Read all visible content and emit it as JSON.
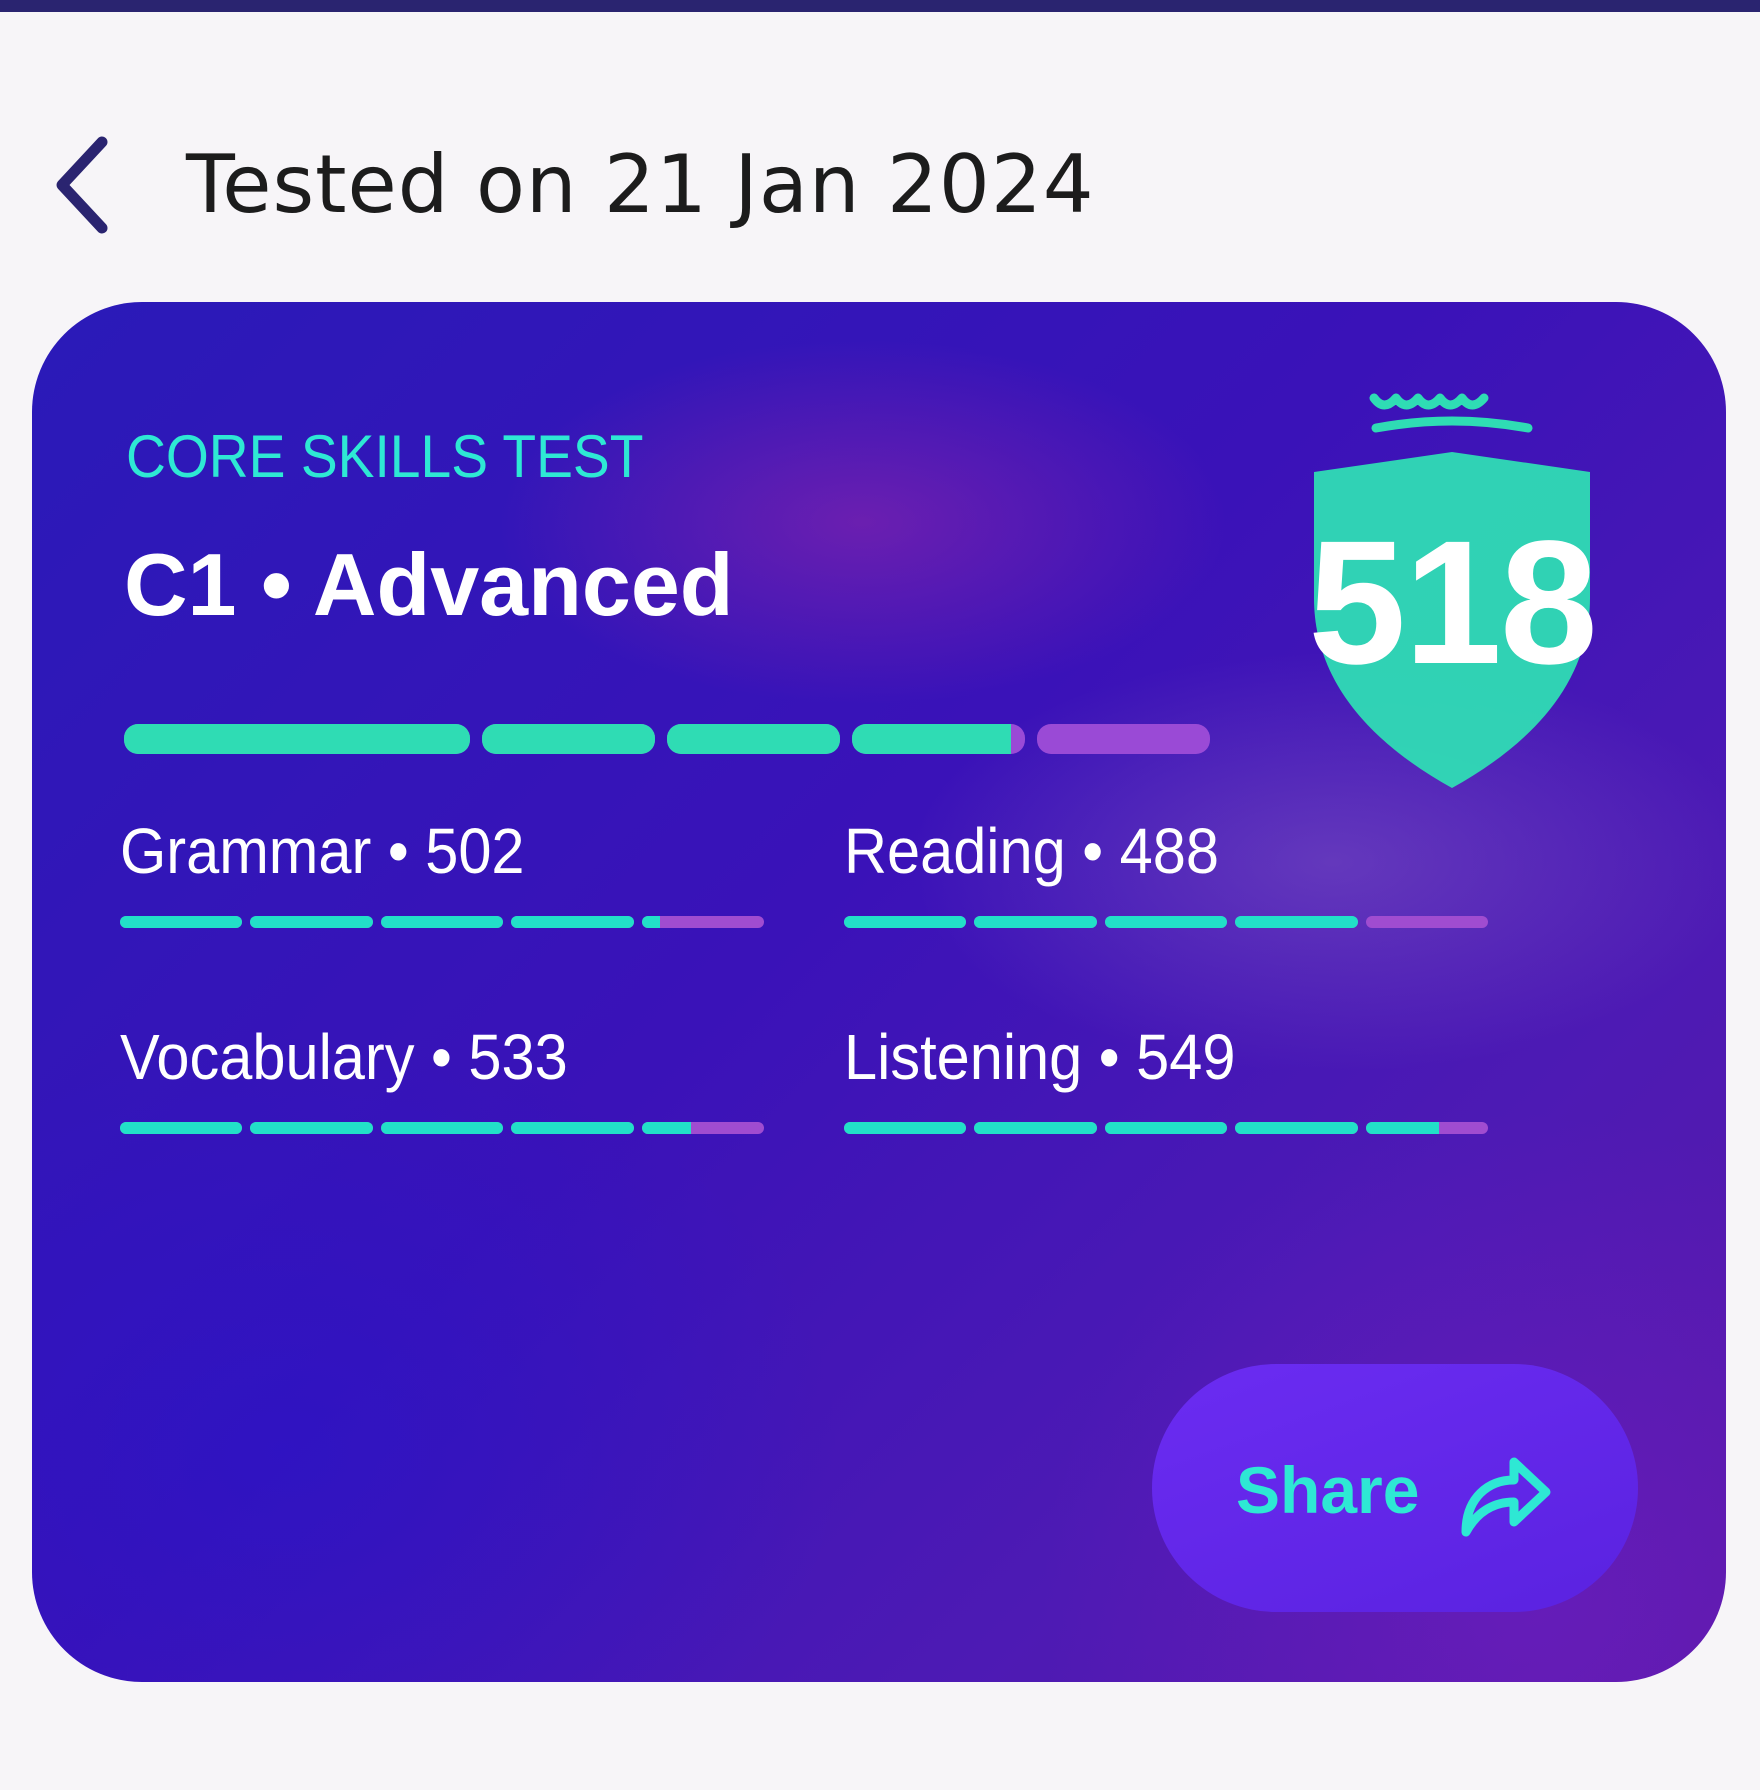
{
  "header": {
    "title": "Tested on 21 Jan 2024",
    "back_icon": "chevron-left-icon"
  },
  "result": {
    "test_name": "CORE SKILLS TEST",
    "level": "C1 • Advanced",
    "overall_score": "518",
    "badge_icon": "crown-shield-icon",
    "level_progress_fraction": 0.82
  },
  "skills": [
    {
      "label": "Grammar • 502",
      "progress_fraction": 0.83
    },
    {
      "label": "Reading • 488",
      "progress_fraction": 0.8
    },
    {
      "label": "Vocabulary • 533",
      "progress_fraction": 0.88
    },
    {
      "label": "Listening • 549",
      "progress_fraction": 0.92
    }
  ],
  "share": {
    "label": "Share",
    "icon": "share-arrow-icon"
  },
  "colors": {
    "accent": "#2ee8d4",
    "progress_fill": "#2fdcb4",
    "progress_remaining": "#9a4ad6",
    "card_bg": "#3a12b8",
    "share_button_bg": "#6b2cf2"
  }
}
